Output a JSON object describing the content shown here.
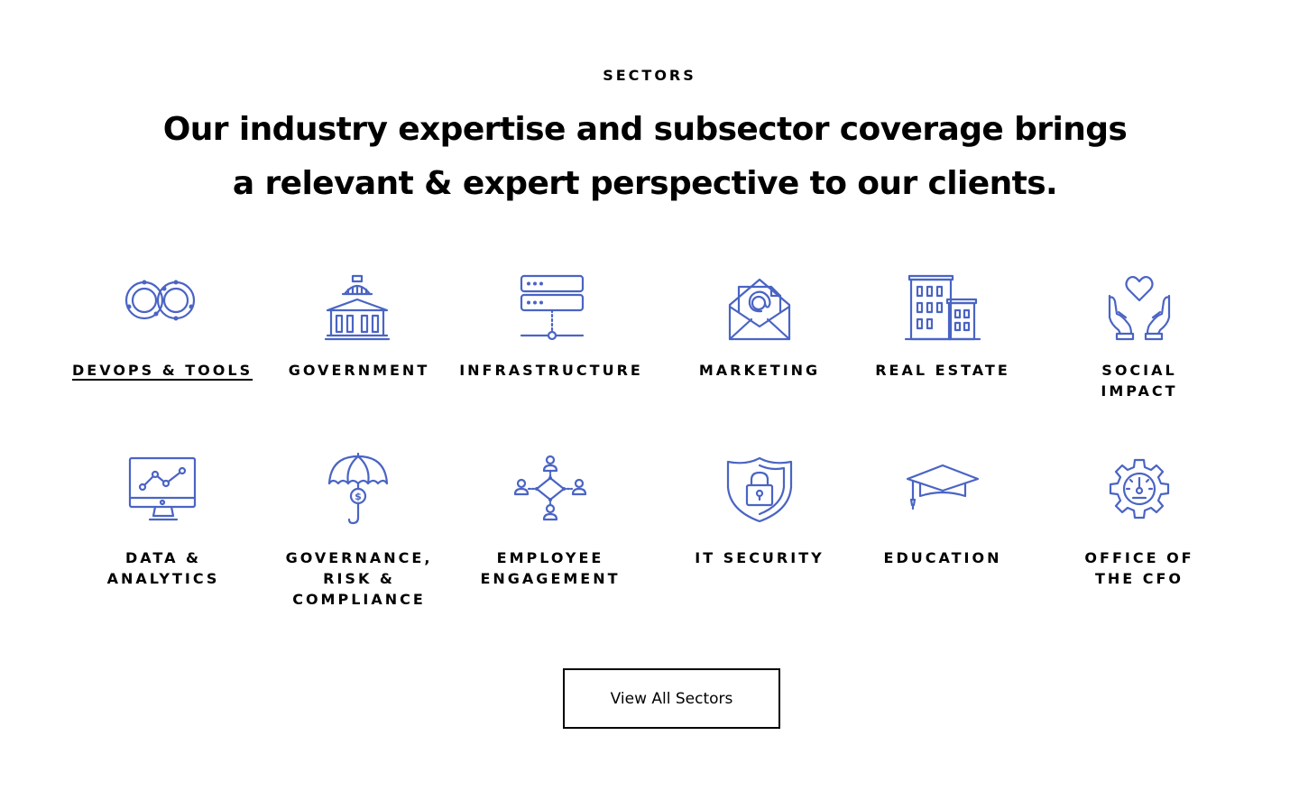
{
  "section": {
    "eyebrow": "SECTORS",
    "headline": "Our industry expertise and subsector coverage brings a relevant & expert perspective to our clients."
  },
  "accent_color": "#4a64c4",
  "sectors": [
    {
      "label": "DEVOPS & TOOLS",
      "icon": "infinity-loop-icon",
      "active": true
    },
    {
      "label": "GOVERNMENT",
      "icon": "capitol-building-icon"
    },
    {
      "label": "INFRASTRUCTURE",
      "icon": "server-rack-icon"
    },
    {
      "label": "MARKETING",
      "icon": "email-envelope-icon"
    },
    {
      "label": "REAL ESTATE",
      "icon": "office-buildings-icon"
    },
    {
      "label": "SOCIAL IMPACT",
      "icon": "hands-heart-icon"
    },
    {
      "label": "DATA & ANALYTICS",
      "icon": "monitor-chart-icon"
    },
    {
      "label": "GOVERNANCE, RISK & COMPLIANCE",
      "icon": "umbrella-dollar-icon"
    },
    {
      "label": "EMPLOYEE ENGAGEMENT",
      "icon": "people-network-icon"
    },
    {
      "label": "IT SECURITY",
      "icon": "shield-lock-icon"
    },
    {
      "label": "EDUCATION",
      "icon": "graduation-cap-icon"
    },
    {
      "label": "OFFICE OF THE CFO",
      "icon": "gear-gauge-icon"
    }
  ],
  "cta": {
    "label": "View All Sectors"
  }
}
